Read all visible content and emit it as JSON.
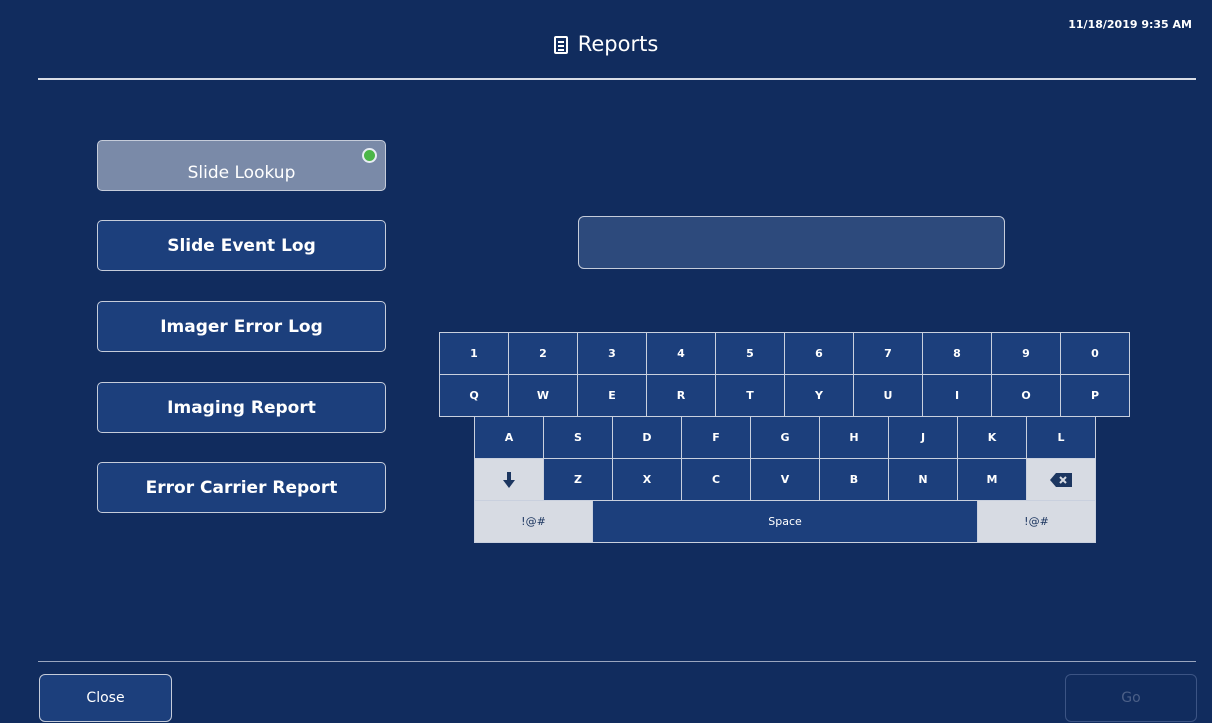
{
  "header": {
    "title": "Reports",
    "timestamp": "11/18/2019 9:35 AM",
    "icon": "document-icon"
  },
  "reports": {
    "items": [
      {
        "label": "Slide Lookup",
        "selected": true
      },
      {
        "label": "Slide Event Log",
        "selected": false
      },
      {
        "label": "Imager Error Log",
        "selected": false
      },
      {
        "label": "Imaging Report",
        "selected": false
      },
      {
        "label": "Error Carrier Report",
        "selected": false
      }
    ]
  },
  "search": {
    "value": "",
    "placeholder": ""
  },
  "keyboard": {
    "row1": [
      "1",
      "2",
      "3",
      "4",
      "5",
      "6",
      "7",
      "8",
      "9",
      "0"
    ],
    "row2": [
      "Q",
      "W",
      "E",
      "R",
      "T",
      "Y",
      "U",
      "I",
      "O",
      "P"
    ],
    "row3": [
      "A",
      "S",
      "D",
      "F",
      "G",
      "H",
      "J",
      "K",
      "L"
    ],
    "row4": [
      "Z",
      "X",
      "C",
      "V",
      "B",
      "N",
      "M"
    ],
    "symbols_label": "!@#",
    "space_label": "Space",
    "shift_icon": "arrow-down-icon",
    "backspace_icon": "backspace-icon"
  },
  "footer": {
    "close_label": "Close",
    "go_label": "Go"
  },
  "colors": {
    "background": "#112c5e",
    "button": "#1c3f7c",
    "selected": "#7a8aa8",
    "indicator": "#4cb648"
  }
}
